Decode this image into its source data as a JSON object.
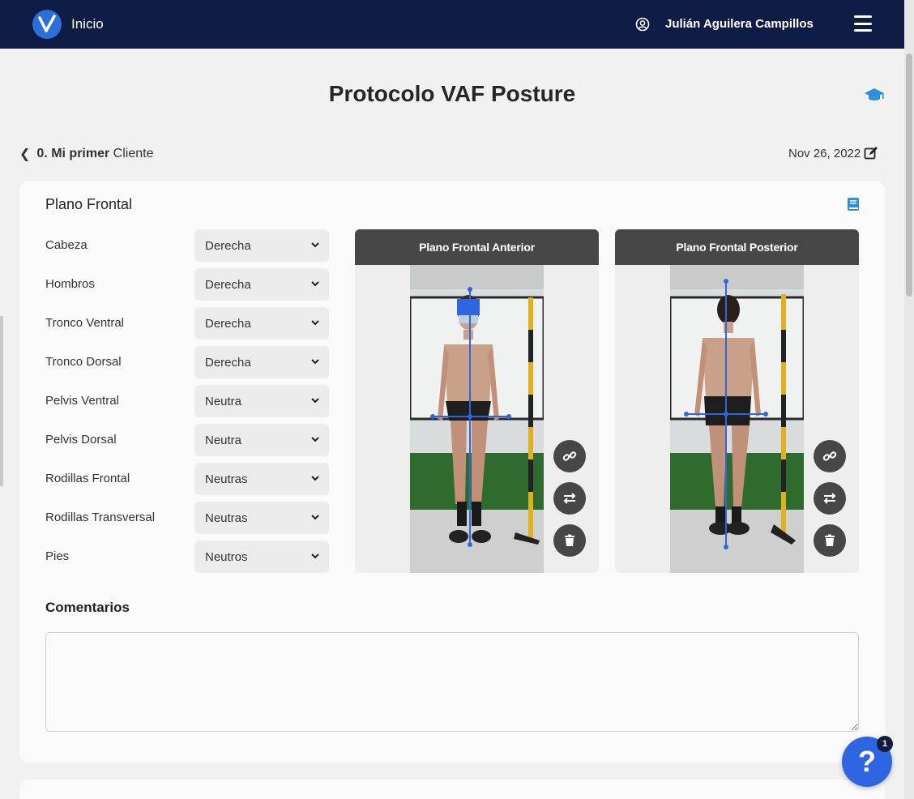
{
  "nav": {
    "home_label": "Inicio",
    "user_name": "Julián Aguilera Campillos"
  },
  "page": {
    "title": "Protocolo VAF Posture"
  },
  "breadcrumb": {
    "bold": "0. Mi primer",
    "rest": "Cliente"
  },
  "date": "Nov 26, 2022",
  "section": {
    "title": "Plano Frontal",
    "fields": [
      {
        "label": "Cabeza",
        "value": "Derecha"
      },
      {
        "label": "Hombros",
        "value": "Derecha"
      },
      {
        "label": "Tronco Ventral",
        "value": "Derecha"
      },
      {
        "label": "Tronco Dorsal",
        "value": "Derecha"
      },
      {
        "label": "Pelvis Ventral",
        "value": "Neutra"
      },
      {
        "label": "Pelvis Dorsal",
        "value": "Neutra"
      },
      {
        "label": "Rodillas Frontal",
        "value": "Neutras"
      },
      {
        "label": "Rodillas Transversal",
        "value": "Neutras"
      },
      {
        "label": "Pies",
        "value": "Neutros"
      }
    ],
    "panels": [
      {
        "title": "Plano Frontal Anterior"
      },
      {
        "title": "Plano Frontal Posterior"
      }
    ]
  },
  "comments": {
    "title": "Comentarios",
    "value": ""
  },
  "help": {
    "label": "?",
    "badge": "1"
  },
  "icons": {
    "logo": "vaf-logo-icon",
    "user": "user-circle-icon",
    "menu": "hamburger-menu-icon",
    "cap": "graduation-cap-icon",
    "book": "book-icon",
    "edit": "edit-icon",
    "link": "link-icon",
    "swap": "swap-icon",
    "delete": "trash-icon"
  },
  "colors": {
    "nav_bg": "#0f1c45",
    "accent": "#2d66e0",
    "panel_header": "#474747"
  }
}
